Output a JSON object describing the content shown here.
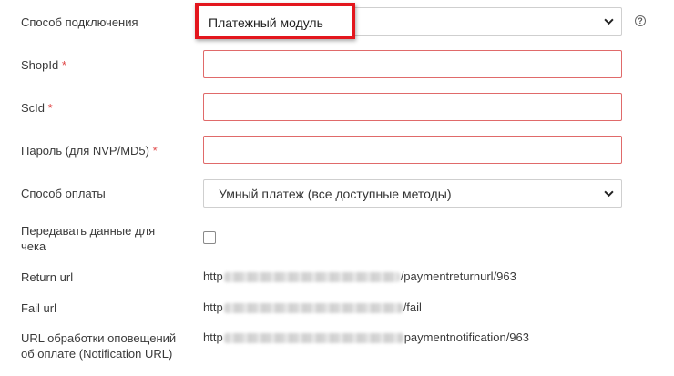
{
  "form": {
    "connection": {
      "label": "Способ подключения",
      "value": "Платежный модуль",
      "help_icon": "question-circle-icon",
      "help_glyph": "?"
    },
    "shop_id": {
      "label": "ShopId",
      "required_mark": "*"
    },
    "sc_id": {
      "label": "ScId",
      "required_mark": "*"
    },
    "password": {
      "label": "Пароль (для NVP/MD5)",
      "required_mark": "*"
    },
    "payment_method": {
      "label": "Способ оплаты",
      "value": "Умный платеж (все доступные методы)"
    },
    "receipt": {
      "label_line1": "Передавать данные для",
      "label_line2": "чека",
      "checked": false
    },
    "return_url": {
      "label": "Return url",
      "prefix": "http",
      "suffix": "/paymentreturnurl/963"
    },
    "fail_url": {
      "label": "Fail url",
      "prefix": "http",
      "suffix": "/fail"
    },
    "notification_url": {
      "label_line1": "URL обработки оповещений",
      "label_line2": "об оплате (Notification URL)",
      "prefix": "http",
      "suffix": "paymentnotification/963"
    }
  },
  "colors": {
    "highlight": "#e3161d",
    "required": "#e04848",
    "error_border": "#e06a6a"
  }
}
